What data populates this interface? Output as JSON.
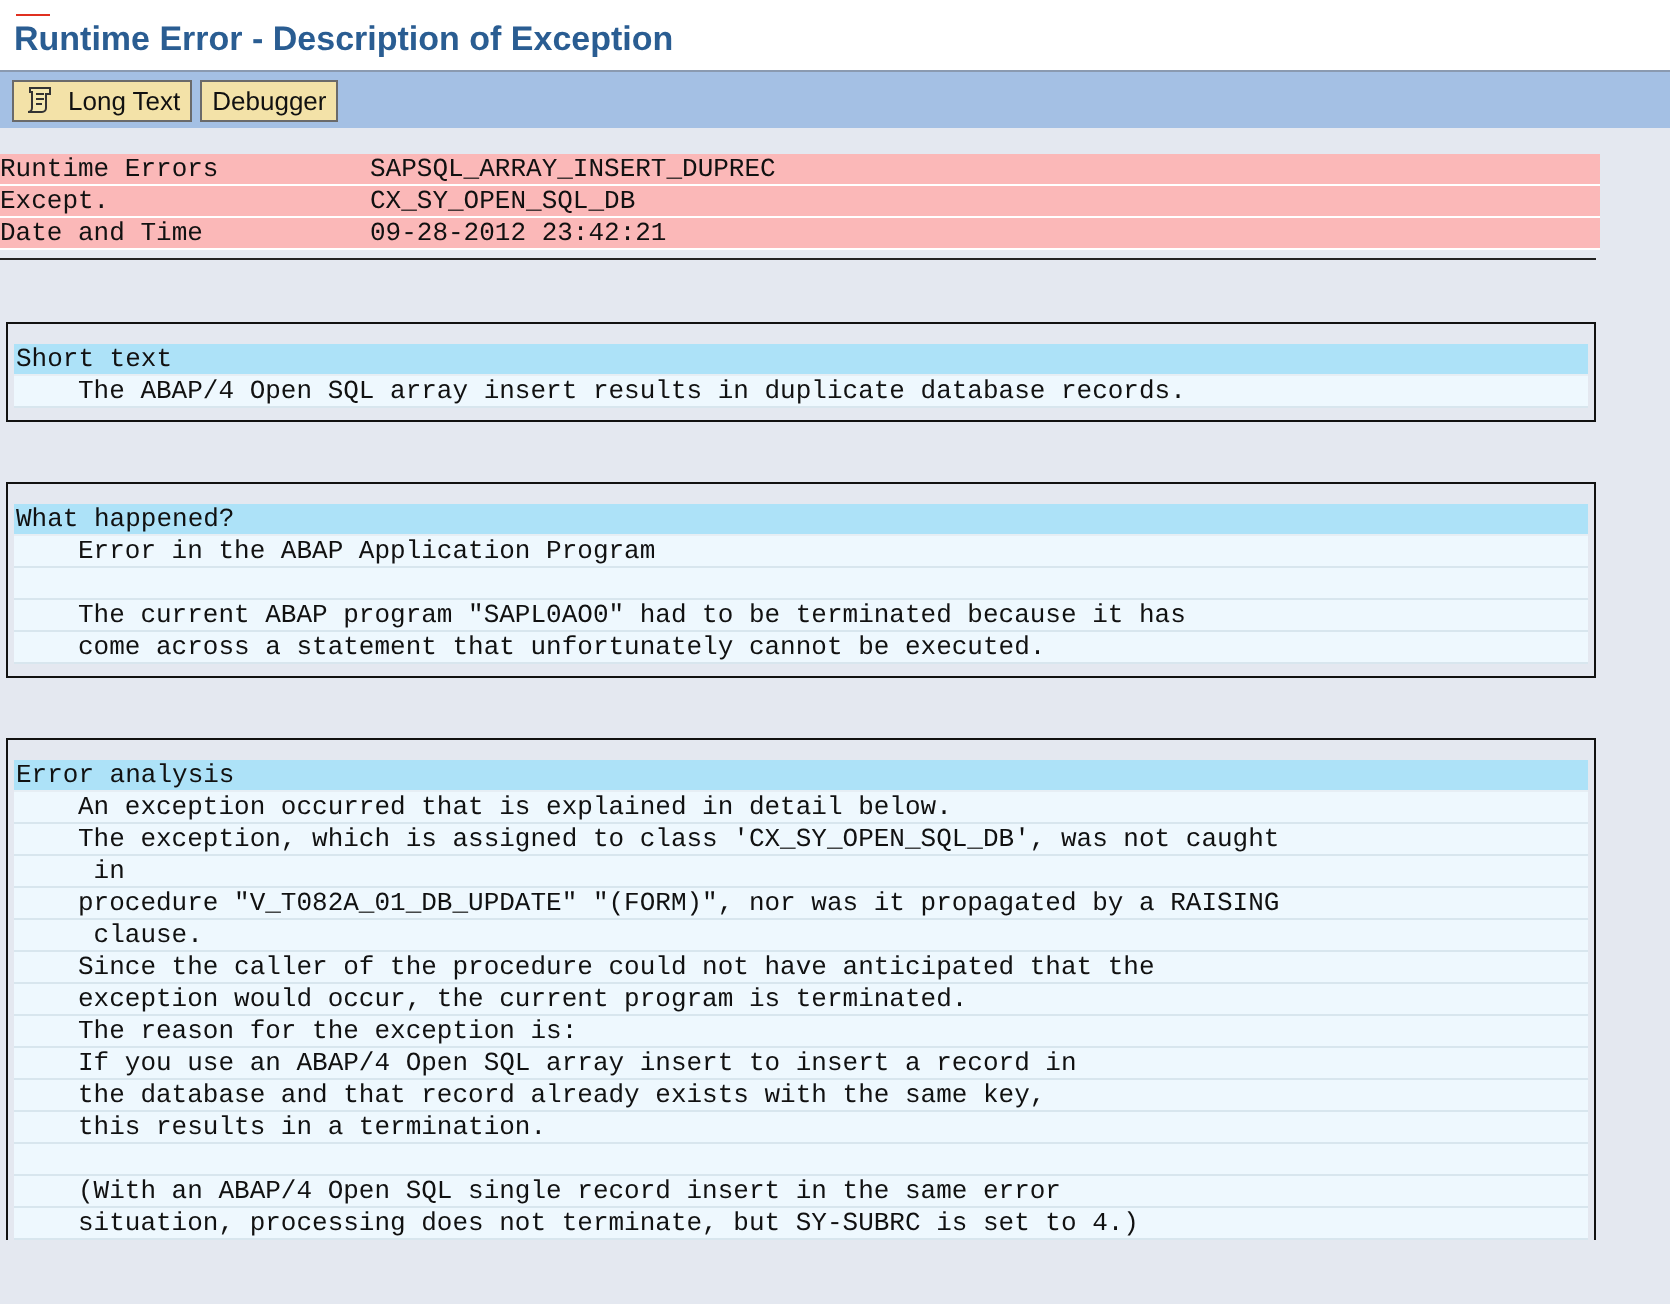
{
  "window": {
    "title": "Runtime Error - Description of Exception"
  },
  "toolbar": {
    "buttons": [
      {
        "label": "Long Text",
        "kind": "icon"
      },
      {
        "label": "Debugger",
        "kind": "plain"
      }
    ]
  },
  "header_fields": [
    {
      "label": "Runtime Errors",
      "value": "SAPSQL_ARRAY_INSERT_DUPREC"
    },
    {
      "label": "Except.",
      "value": "CX_SY_OPEN_SQL_DB"
    },
    {
      "label": "Date and Time",
      "value": "09-28-2012 23:42:21"
    }
  ],
  "sections": [
    {
      "heading": "Short text",
      "lines": [
        {
          "kind": "text",
          "text": "The ABAP/4 Open SQL array insert results in duplicate database records."
        }
      ]
    },
    {
      "heading": "What happened?",
      "lines": [
        {
          "kind": "text",
          "text": "Error in the ABAP Application Program"
        },
        {
          "kind": "blank"
        },
        {
          "kind": "text",
          "text": "The current ABAP program \"SAPL0AO0\" had to be terminated because it has"
        },
        {
          "kind": "text",
          "text": "come across a statement that unfortunately cannot be executed."
        }
      ]
    },
    {
      "heading": "Error analysis",
      "lines": [
        {
          "kind": "text",
          "text": "An exception occurred that is explained in detail below."
        },
        {
          "kind": "text",
          "text": "The exception, which is assigned to class 'CX_SY_OPEN_SQL_DB', was not caught"
        },
        {
          "kind": "text",
          "text": " in"
        },
        {
          "kind": "text",
          "text": "procedure \"V_T082A_01_DB_UPDATE\" \"(FORM)\", nor was it propagated by a RAISING"
        },
        {
          "kind": "text",
          "text": " clause."
        },
        {
          "kind": "text",
          "text": "Since the caller of the procedure could not have anticipated that the"
        },
        {
          "kind": "text",
          "text": "exception would occur, the current program is terminated."
        },
        {
          "kind": "text",
          "text": "The reason for the exception is:"
        },
        {
          "kind": "text",
          "text": "If you use an ABAP/4 Open SQL array insert to insert a record in"
        },
        {
          "kind": "text",
          "text": "the database and that record already exists with the same key,"
        },
        {
          "kind": "text",
          "text": "this results in a termination."
        },
        {
          "kind": "blank"
        },
        {
          "kind": "text",
          "text": "(With an ABAP/4 Open SQL single record insert in the same error"
        },
        {
          "kind": "text",
          "text": "situation, processing does not terminate, but SY-SUBRC is set to 4.)"
        }
      ]
    }
  ]
}
